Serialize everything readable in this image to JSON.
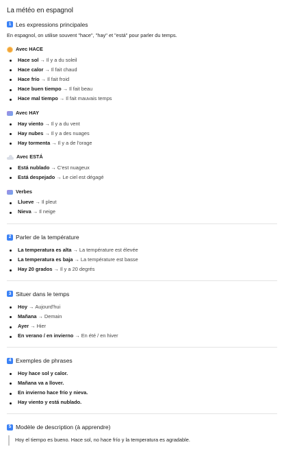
{
  "title": "La météo en espagnol",
  "sections": {
    "s1": {
      "num": "1",
      "title": "Les expressions principales",
      "intro": "En espagnol, on utilise souvent \"hace\", \"hay\" et \"está\" pour parler du temps.",
      "groups": {
        "hace": {
          "icon": "sun-icon",
          "label": "Avec HACE",
          "items": [
            {
              "es": "Hace sol",
              "fr": "Il y a du soleil"
            },
            {
              "es": "Hace calor",
              "fr": "Il fait chaud"
            },
            {
              "es": "Hace frío",
              "fr": "Il fait froid"
            },
            {
              "es": "Hace buen tiempo",
              "fr": "Il fait beau"
            },
            {
              "es": "Hace mal tiempo",
              "fr": "Il fait mauvais temps"
            }
          ]
        },
        "hay": {
          "icon": "wind-icon",
          "label": "Avec HAY",
          "items": [
            {
              "es": "Hay viento",
              "fr": "Il y a du vent"
            },
            {
              "es": "Hay nubes",
              "fr": "Il y a des nuages"
            },
            {
              "es": "Hay tormenta",
              "fr": "Il y a de l'orage"
            }
          ]
        },
        "esta": {
          "icon": "cloud-icon",
          "label": "Avec ESTÁ",
          "items": [
            {
              "es": "Está nublado",
              "fr": "C'est nuageux"
            },
            {
              "es": "Está despejado",
              "fr": "Le ciel est dégagé"
            }
          ]
        },
        "verbes": {
          "icon": "rain-icon",
          "label": "Verbes",
          "items": [
            {
              "es": "Llueve",
              "fr": "Il pleut"
            },
            {
              "es": "Nieva",
              "fr": "Il neige"
            }
          ]
        }
      }
    },
    "s2": {
      "num": "2",
      "title": "Parler de la température",
      "items": [
        {
          "es": "La temperatura es alta",
          "fr": "La température est élevée"
        },
        {
          "es": "La temperatura es baja",
          "fr": "La température est basse"
        },
        {
          "es": "Hay 20 grados",
          "fr": "Il y a 20 degrés"
        }
      ]
    },
    "s3": {
      "num": "3",
      "title": "Situer dans le temps",
      "items": [
        {
          "es": "Hoy",
          "fr": "Aujourd'hui"
        },
        {
          "es": "Mañana",
          "fr": "Demain"
        },
        {
          "es": "Ayer",
          "fr": "Hier"
        },
        {
          "es": "En verano / en invierno",
          "fr": "En été / en hiver"
        }
      ]
    },
    "s4": {
      "num": "4",
      "title": "Exemples de phrases",
      "items": [
        "Hoy hace sol y calor.",
        "Mañana va a llover.",
        "En invierno hace frío y nieva.",
        "Hay viento y está nublado."
      ]
    },
    "s5": {
      "num": "5",
      "title": "Modèle de description (à apprendre)",
      "quote": "Hoy el tiempo es bueno. Hace sol, no hace frío y la temperatura es agradable."
    }
  },
  "arrow": "→"
}
